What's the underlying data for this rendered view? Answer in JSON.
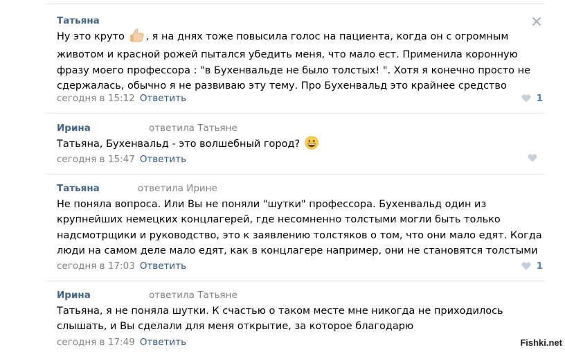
{
  "comments": [
    {
      "author": "Татьяна",
      "reply_to": "",
      "lines": [
        "Ну это круто ",
        ", я на днях тоже повысила голос на пациента, когда он с огромным",
        "животом и красной рожей пытался убедить меня, что мало ест. Применила коронную",
        "фразу моего профессора : \"в Бухенвальде не было толстых! \". Хотя я конечно просто не",
        "сдержалась, обычно я не развиваю эту тему. Про Бухенвальд это крайнее средство"
      ],
      "inline_emoji": "thumbs-up",
      "date": "сегодня в 15:12",
      "reply_label": "Ответить",
      "likes": "1"
    },
    {
      "author": "Ирина",
      "reply_to": "ответила Татьяне",
      "lines": [
        "Татьяна, Бухенвальд - это волшебный город? "
      ],
      "inline_emoji": "grinning-face",
      "date": "сегодня в 15:47",
      "reply_label": "Ответить",
      "likes": ""
    },
    {
      "author": "Татьяна",
      "reply_to": "ответила Ирине",
      "lines": [
        "Не поняла вопроса. Или Вы не поняли \"шутки\" профессора. Бухенвальд один из",
        "крупнейших немецких концлагерей, где несомненно толстыми могли быть только",
        "надсмотрщики и руководство, это к заявлению толстяков о том, что они мало едят. Когда",
        "люди на самом деле мало едят, как в концлагере например, они не становятся толстыми"
      ],
      "date": "сегодня в 17:03",
      "reply_label": "Ответить",
      "likes": "1"
    },
    {
      "author": "Ирина",
      "reply_to": "ответила Татьяне",
      "lines": [
        "Татьяна, я не поняла шутки. К счастью о таком месте мне никогда не приходилось",
        "слышать, и Вы сделали для меня открытие, за которое благодарю"
      ],
      "date": "сегодня в 17:49",
      "reply_label": "Ответить",
      "likes": ""
    }
  ],
  "colors": {
    "author": "#42648b",
    "meta": "#828282",
    "reply_link": "#2a5885",
    "like_active": "#5181b8",
    "like_inactive": "#c5d0db",
    "divider": "#e7e8ec"
  },
  "icons": {
    "close": "close-icon",
    "like": "heart-icon"
  },
  "watermark": "Fishki.net"
}
